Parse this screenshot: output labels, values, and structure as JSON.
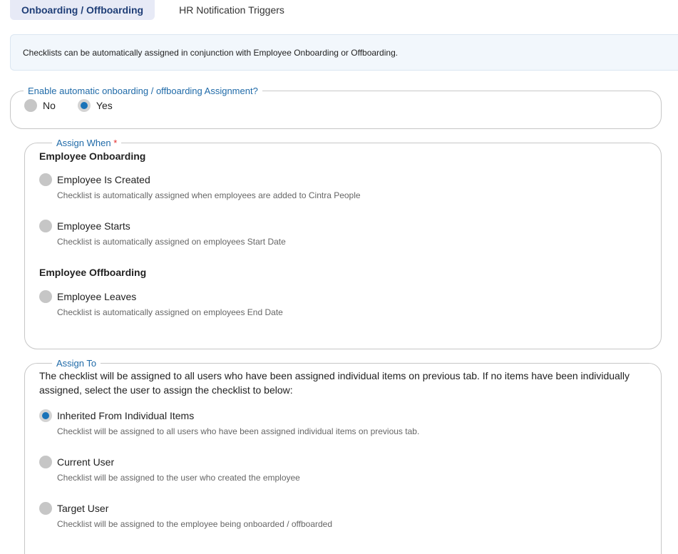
{
  "tabs": [
    {
      "label": "Onboarding / Offboarding",
      "active": true
    },
    {
      "label": "HR Notification Triggers",
      "active": false
    }
  ],
  "info_banner": "Checklists can be automatically assigned in conjunction with Employee Onboarding or Offboarding.",
  "enable_section": {
    "legend": "Enable automatic onboarding / offboarding Assignment?",
    "options": [
      {
        "label": "No",
        "selected": false
      },
      {
        "label": "Yes",
        "selected": true
      }
    ]
  },
  "assign_when": {
    "legend": "Assign When",
    "required_marker": "*",
    "onboarding": {
      "title": "Employee Onboarding",
      "options": [
        {
          "label": "Employee Is Created",
          "description": "Checklist is automatically assigned when employees are added to Cintra People",
          "selected": false
        },
        {
          "label": "Employee Starts",
          "description": "Checklist is automatically assigned on employees Start Date",
          "selected": false
        }
      ]
    },
    "offboarding": {
      "title": "Employee Offboarding",
      "options": [
        {
          "label": "Employee Leaves",
          "description": "Checklist is automatically assigned on employees End Date",
          "selected": false
        }
      ]
    }
  },
  "assign_to": {
    "legend": "Assign To",
    "intro": "The checklist will be assigned to all users who have been assigned individual items on previous tab. If no items have been individually assigned, select the user to assign the checklist to below:",
    "options": [
      {
        "label": "Inherited From Individual Items",
        "description": "Checklist will be assigned to all users who have been assigned individual items on previous tab.",
        "selected": true
      },
      {
        "label": "Current User",
        "description": "Checklist will be assigned to the user who created the employee",
        "selected": false
      },
      {
        "label": "Target User",
        "description": "Checklist will be assigned to the employee being onboarded / offboarded",
        "selected": false
      }
    ]
  },
  "colors": {
    "accent": "#1a73b8",
    "legend_text": "#1f6aa8",
    "active_tab_bg": "#e7eaf6",
    "active_tab_text": "#1f3e77",
    "info_bg": "#f2f7fc",
    "required": "#e32b2b"
  }
}
